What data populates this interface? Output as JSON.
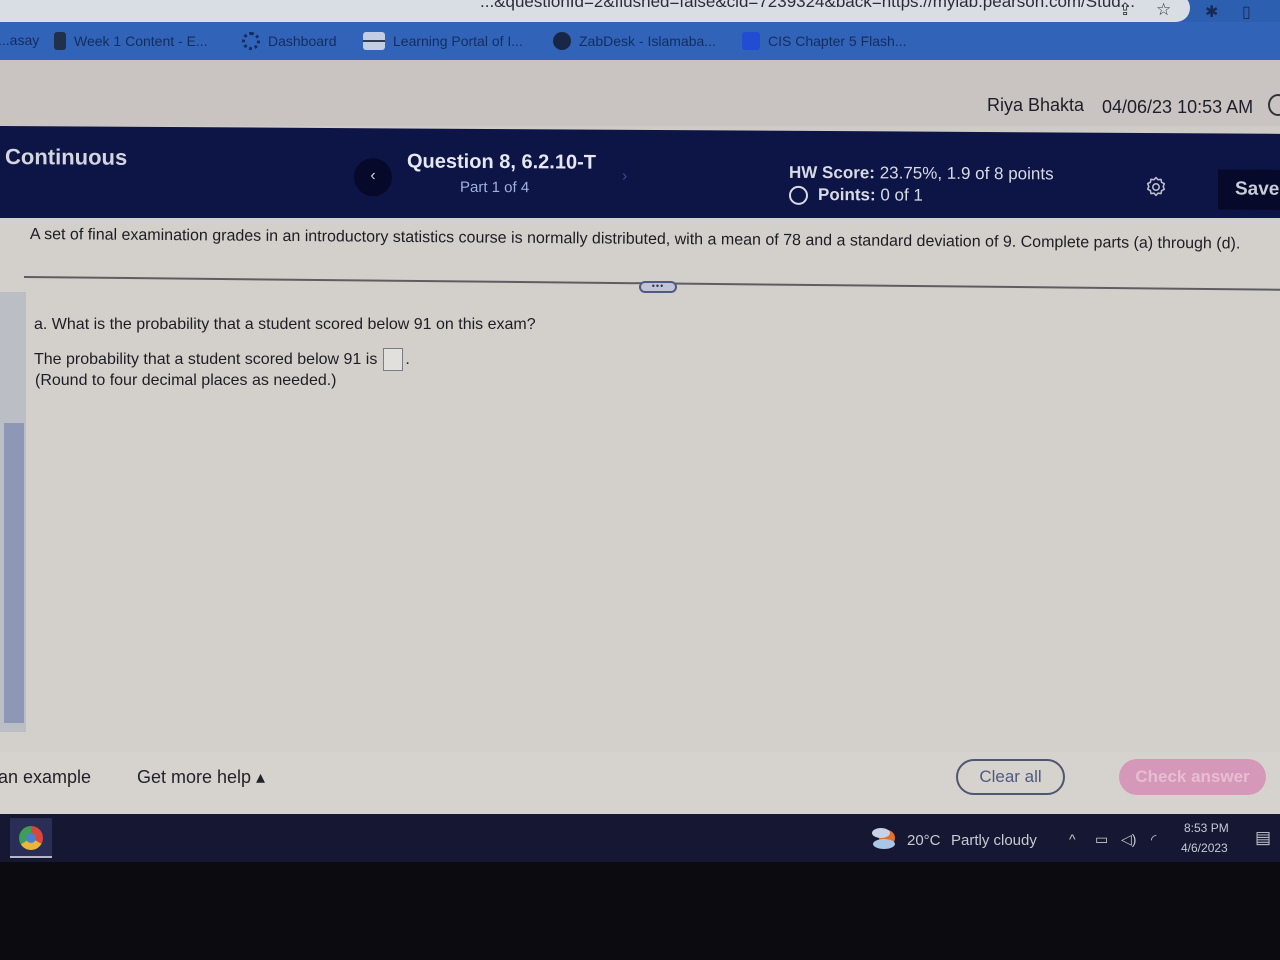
{
  "browser": {
    "url_fragment": "...&questionId=2&flushed=false&cid=7239324&back=https://mylab.pearson.com/Stud...",
    "share_icon": "share-icon",
    "star_icon": "bookmark-star-icon",
    "bookmarks": [
      {
        "label": "...asay",
        "icon": "bookmark-icon"
      },
      {
        "label": "Week 1 Content - E...",
        "icon": "document-icon"
      },
      {
        "label": "Dashboard",
        "icon": "dashboard-icon"
      },
      {
        "label": "Learning Portal of I...",
        "icon": "portal-icon"
      },
      {
        "label": "ZabDesk - Islamaba...",
        "icon": "globe-icon"
      },
      {
        "label": "CIS Chapter 5 Flash...",
        "icon": "quizlet-icon"
      }
    ]
  },
  "user": {
    "name": "Riya Bhakta",
    "datetime": "04/06/23 10:53 AM"
  },
  "header": {
    "mode": "Continuous",
    "prev_label": "‹",
    "next_label": "›",
    "question_title": "Question 8, 6.2.10-T",
    "part": "Part 1 of 4",
    "hw_score_label": "HW Score:",
    "hw_score_value": " 23.75%, 1.9 of 8 points",
    "points_label": "Points:",
    "points_value": " 0 of 1",
    "settings_icon": "gear-icon",
    "save_label": "Save"
  },
  "question": {
    "intro": "A set of final examination grades in an introductory statistics course is normally distributed, with a mean of 78 and a standard deviation of 9. Complete parts (a) through (d).",
    "expand_label": "•••",
    "part_letter": "a.",
    "part_text": " What is the probability that a student scored below 91 on this exam?",
    "answer_prompt": "The probability that a student scored below 91 is",
    "answer_value": "",
    "answer_suffix": ".",
    "hint": "(Round to four decimal places as needed.)"
  },
  "actions": {
    "example_label": "an example",
    "help_label": "Get more help ▴",
    "clear_label": "Clear all",
    "check_label": "Check answer"
  },
  "taskbar": {
    "temperature": "20°C",
    "condition": "Partly cloudy",
    "time": "8:53 PM",
    "date": "4/6/2023",
    "tray_up": "^",
    "battery_icon": "battery-icon",
    "volume_icon": "volume-icon",
    "wifi_icon": "wifi-icon"
  }
}
